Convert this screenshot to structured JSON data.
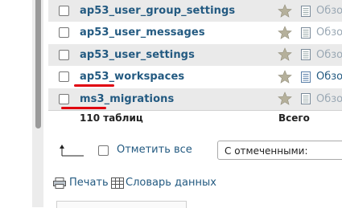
{
  "tables": [
    {
      "name": "ap53_user_group_settings",
      "action": "Обзор"
    },
    {
      "name": "ap53_user_messages",
      "action": "Обзор"
    },
    {
      "name": "ap53_user_settings",
      "action": "Обзор"
    },
    {
      "name": "ap53_workspaces",
      "action": "Обзор"
    },
    {
      "name": "ms3_migrations",
      "action": "Обзор"
    }
  ],
  "summary": {
    "count_label": "110 таблиц",
    "total_label": "Всего"
  },
  "bulk": {
    "check_all_label": "Отметить все",
    "with_selected_value": "С отмеченными:"
  },
  "links": {
    "print_label": "Печать",
    "dictionary_label": "Словарь данных"
  },
  "colors": {
    "link": "#235a81",
    "highlight_underline": "#e0000f",
    "row_alt": "#eaeaea"
  }
}
